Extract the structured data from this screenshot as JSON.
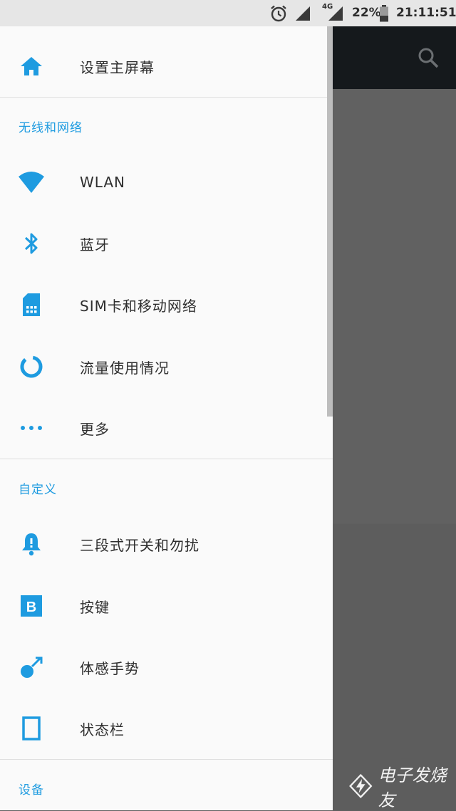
{
  "status_bar": {
    "battery_percent": "22%",
    "network_type": "4G",
    "time": "21:11:51",
    "icons": [
      "alarm-icon",
      "signal-icon",
      "battery-icon"
    ]
  },
  "drawer": {
    "top_item": {
      "label": "设置主屏幕",
      "icon": "home-icon"
    },
    "sections": [
      {
        "title": "无线和网络",
        "items": [
          {
            "label": "WLAN",
            "icon": "wifi-icon"
          },
          {
            "label": "蓝牙",
            "icon": "bluetooth-icon"
          },
          {
            "label": "SIM卡和移动网络",
            "icon": "sim-card-icon"
          },
          {
            "label": "流量使用情况",
            "icon": "data-usage-icon"
          },
          {
            "label": "更多",
            "icon": "more-icon"
          }
        ]
      },
      {
        "title": "自定义",
        "items": [
          {
            "label": "三段式开关和勿扰",
            "icon": "bell-icon"
          },
          {
            "label": "按键",
            "icon": "buttons-icon"
          },
          {
            "label": "体感手势",
            "icon": "gesture-icon"
          },
          {
            "label": "状态栏",
            "icon": "status-bar-icon"
          }
        ]
      },
      {
        "title": "设备",
        "items": []
      }
    ]
  },
  "background_app": {
    "search_icon": "search-icon"
  },
  "watermark": {
    "text": "电子发烧友"
  },
  "colors": {
    "accent": "#1e9be0",
    "drawer_bg": "#fafafa",
    "appbar_bg": "#15191c",
    "scrim": "#616161"
  }
}
